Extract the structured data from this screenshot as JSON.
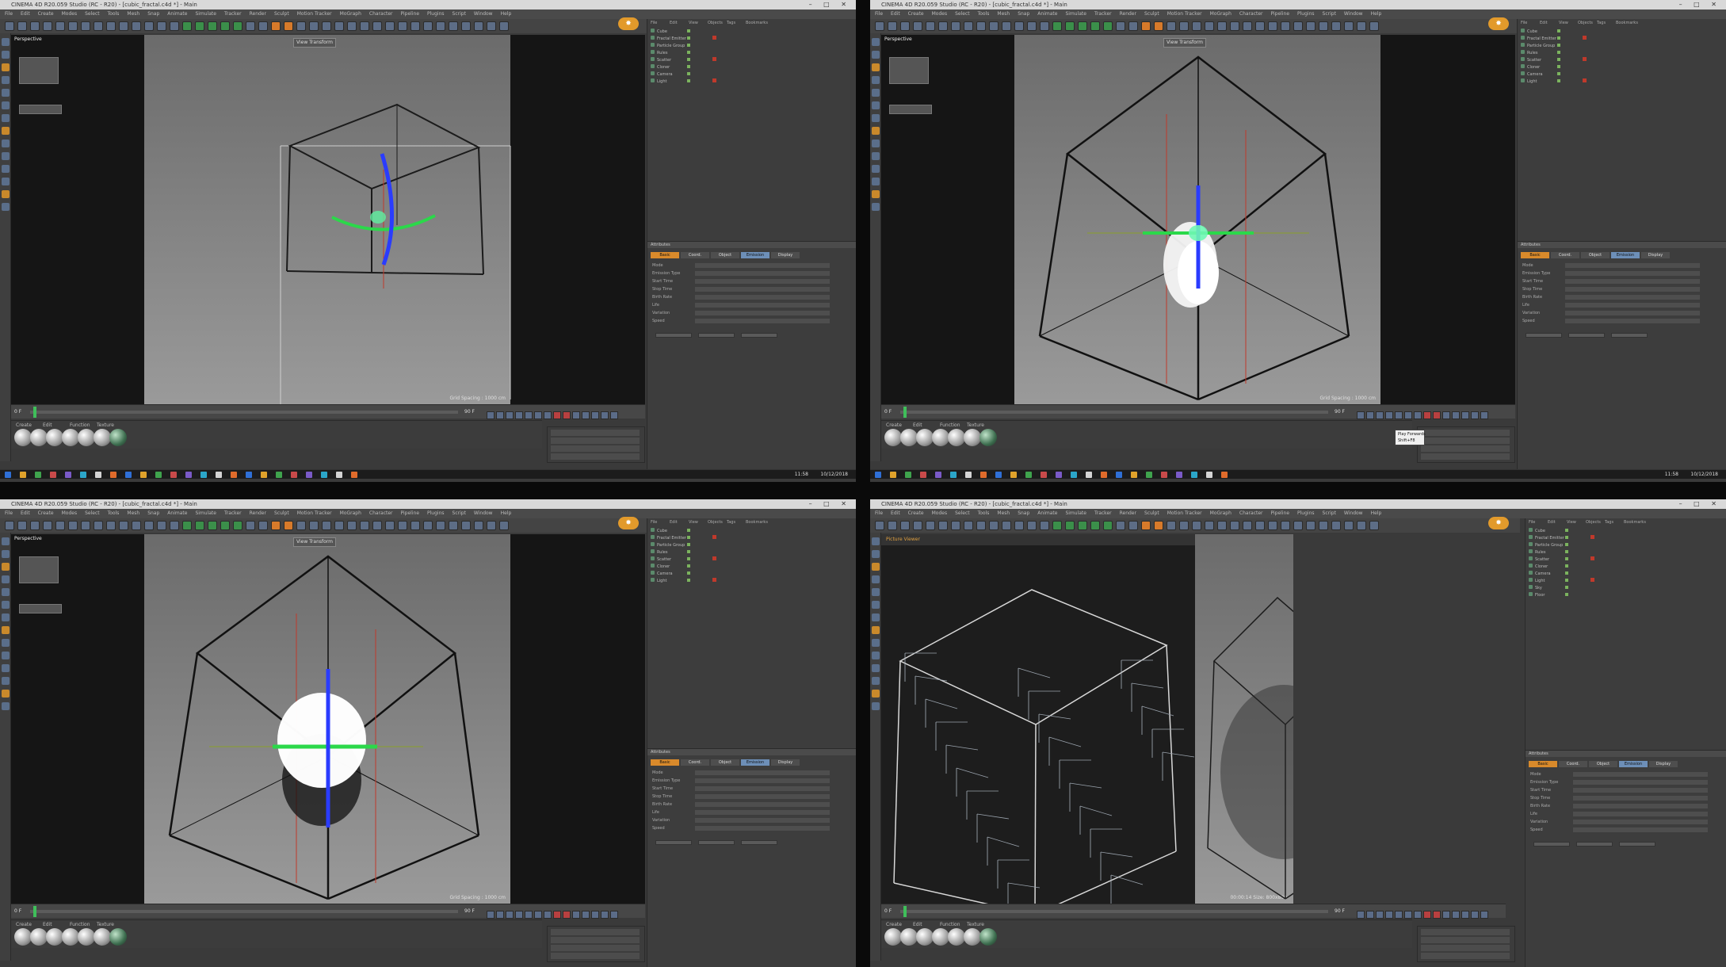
{
  "window": {
    "title": "CINEMA 4D R20.059 Studio (RC - R20) - [cubic_fractal.c4d *] - Main",
    "controls": "– □ ✕",
    "menu": [
      "File",
      "Edit",
      "Create",
      "Modes",
      "Select",
      "Tools",
      "Mesh",
      "Snap",
      "Animate",
      "Simulate",
      "Tracker",
      "Render",
      "Sculpt",
      "Motion Tracker",
      "MoGraph",
      "Character",
      "Pipeline",
      "Plugins",
      "Script",
      "Window",
      "Help"
    ],
    "logo": "✸"
  },
  "colors": {
    "accent_orange": "#d98a2b",
    "axis_blue": "#2a3cff",
    "axis_green": "#2bd84a",
    "viewport_bg": "#8a8a8a",
    "black_bar": "#151515"
  },
  "quadrants": [
    {
      "id": "q1",
      "viewport_label": "Perspective",
      "view_hud": "View Transform",
      "render_status": "Grid Spacing : 1000 cm",
      "timeline": {
        "start": "0 F",
        "end": "90 F"
      },
      "material_tabs": [
        "Create",
        "Edit",
        "Function",
        "Texture"
      ]
    },
    {
      "id": "q2",
      "viewport_label": "Perspective",
      "view_hud": "View Transform",
      "render_status": "Grid Spacing : 1000 cm",
      "tooltip": "Play Forwards\nShift+F8",
      "timeline": {
        "start": "0 F",
        "end": "90 F"
      },
      "material_tabs": [
        "Create",
        "Edit",
        "Function",
        "Texture"
      ]
    },
    {
      "id": "q3",
      "viewport_label": "Perspective",
      "view_hud": "View Transform",
      "render_status": "Grid Spacing : 1000 cm",
      "timeline": {
        "start": "0 F",
        "end": "90 F"
      },
      "material_tabs": [
        "Create",
        "Edit",
        "Function",
        "Texture"
      ]
    },
    {
      "id": "q4",
      "viewport_label": "Perspective",
      "view_hud": "Picture Viewer",
      "render_status": "00:00:14  Size: 800x800",
      "timeline": {
        "start": "0 F",
        "end": "90 F"
      },
      "material_tabs": [
        "Create",
        "Edit",
        "Function",
        "Texture"
      ]
    }
  ],
  "object_manager": {
    "tabs": [
      "File",
      "Edit",
      "View",
      "Objects",
      "Tags",
      "Bookmarks"
    ],
    "items": [
      "Cube",
      "Fractal Emitter",
      "Particle Group",
      "Rules",
      "Scatter",
      "Cloner",
      "Camera",
      "Light",
      "Sky",
      "Floor"
    ]
  },
  "attributes": {
    "tabs": [
      "Basic",
      "Coord.",
      "Object",
      "Emission",
      "Display"
    ],
    "header": "Attributes",
    "labels": [
      "Mode",
      "Emission Type",
      "Start Time",
      "Stop Time",
      "Birth Rate",
      "Life",
      "Variation",
      "Speed"
    ]
  },
  "taskbar": {
    "clock": "11:58",
    "date": "10/12/2018"
  }
}
